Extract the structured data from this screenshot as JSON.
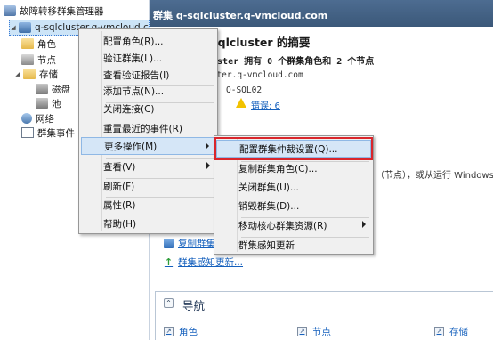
{
  "tree": {
    "root_label": "故障转移群集管理器",
    "cluster_label": "q-sqlcluster.q-vmcloud.c",
    "items": [
      {
        "label": "角色"
      },
      {
        "label": "节点"
      },
      {
        "label": "存储"
      },
      {
        "label": "磁盘"
      },
      {
        "label": "池"
      },
      {
        "label": "网络"
      },
      {
        "label": "群集事件"
      }
    ]
  },
  "header": {
    "title": "群集 q-sqlcluster.q-vmcloud.com"
  },
  "summary": {
    "title": "-sqlcluster 的摘要",
    "desc": "luster 拥有 0 个群集角色和 2 个节点",
    "line3": "uster.q-vmcloud.com",
    "line4": "Q-SQL02",
    "line5": "件:",
    "errors_link": "错误: 6",
    "configure_text": "（节点），或从运行 Windows S"
  },
  "actions": [
    {
      "label": "复制群集"
    },
    {
      "label": "群集感知更新..."
    }
  ],
  "navigation": {
    "title": "导航",
    "links": [
      {
        "label": "角色"
      },
      {
        "label": "节点"
      },
      {
        "label": "存储"
      }
    ]
  },
  "context_menu": {
    "items": [
      {
        "label": "配置角色(R)..."
      },
      {
        "label": "验证群集(L)..."
      },
      {
        "label": "查看验证报告(I)"
      },
      {
        "label": "添加节点(N)..."
      },
      {
        "label": "关闭连接(C)"
      },
      {
        "label": "重置最近的事件(R)"
      },
      {
        "label": "更多操作(M)"
      },
      {
        "label": "查看(V)"
      },
      {
        "label": "刷新(F)"
      },
      {
        "label": "属性(R)"
      },
      {
        "label": "帮助(H)"
      }
    ]
  },
  "submenu": {
    "items": [
      {
        "label": "配置群集仲裁设置(Q)..."
      },
      {
        "label": "复制群集角色(C)..."
      },
      {
        "label": "关闭群集(U)..."
      },
      {
        "label": "销毁群集(D)..."
      },
      {
        "label": "移动核心群集资源(R)"
      },
      {
        "label": "群集感知更新"
      }
    ]
  },
  "colors": {
    "header_bg": "#3f5d80",
    "link": "#1560bd",
    "highlight_border": "#d9262c",
    "menu_hover": "#d5e6f7"
  }
}
